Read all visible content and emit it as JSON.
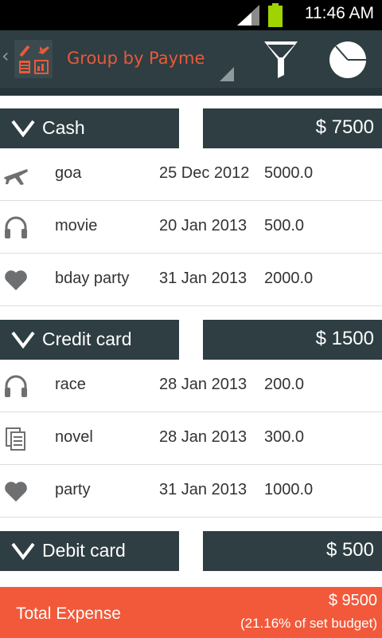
{
  "status_bar": {
    "time": "11:46 AM"
  },
  "action_bar": {
    "spinner_value": "Group by Payme"
  },
  "groups": [
    {
      "name": "Cash",
      "total": "$ 7500",
      "items": [
        {
          "icon": "airplane-icon",
          "name": "goa",
          "date": "25 Dec 2012",
          "amount": "5000.0"
        },
        {
          "icon": "headphones-icon",
          "name": "movie",
          "date": "20 Jan 2013",
          "amount": "500.0"
        },
        {
          "icon": "heart-icon",
          "name": "bday party",
          "date": "31 Jan 2013",
          "amount": "2000.0"
        }
      ]
    },
    {
      "name": "Credit card",
      "total": "$ 1500",
      "items": [
        {
          "icon": "headphones-icon",
          "name": "race",
          "date": "28 Jan 2013",
          "amount": "200.0"
        },
        {
          "icon": "documents-icon",
          "name": "novel",
          "date": "28 Jan 2013",
          "amount": "300.0"
        },
        {
          "icon": "heart-icon",
          "name": "party",
          "date": "31 Jan 2013",
          "amount": "1000.0"
        }
      ]
    },
    {
      "name": "Debit card",
      "total": "$ 500",
      "items": []
    }
  ],
  "footer": {
    "label": "Total Expense",
    "total": "$ 9500",
    "budget_percent": "(21.16% of set budget)"
  },
  "colors": {
    "header_bg": "#2e3e42",
    "accent": "#f2593a",
    "spinner_text": "#e85a3a",
    "icon_gray": "#6d6f70"
  }
}
